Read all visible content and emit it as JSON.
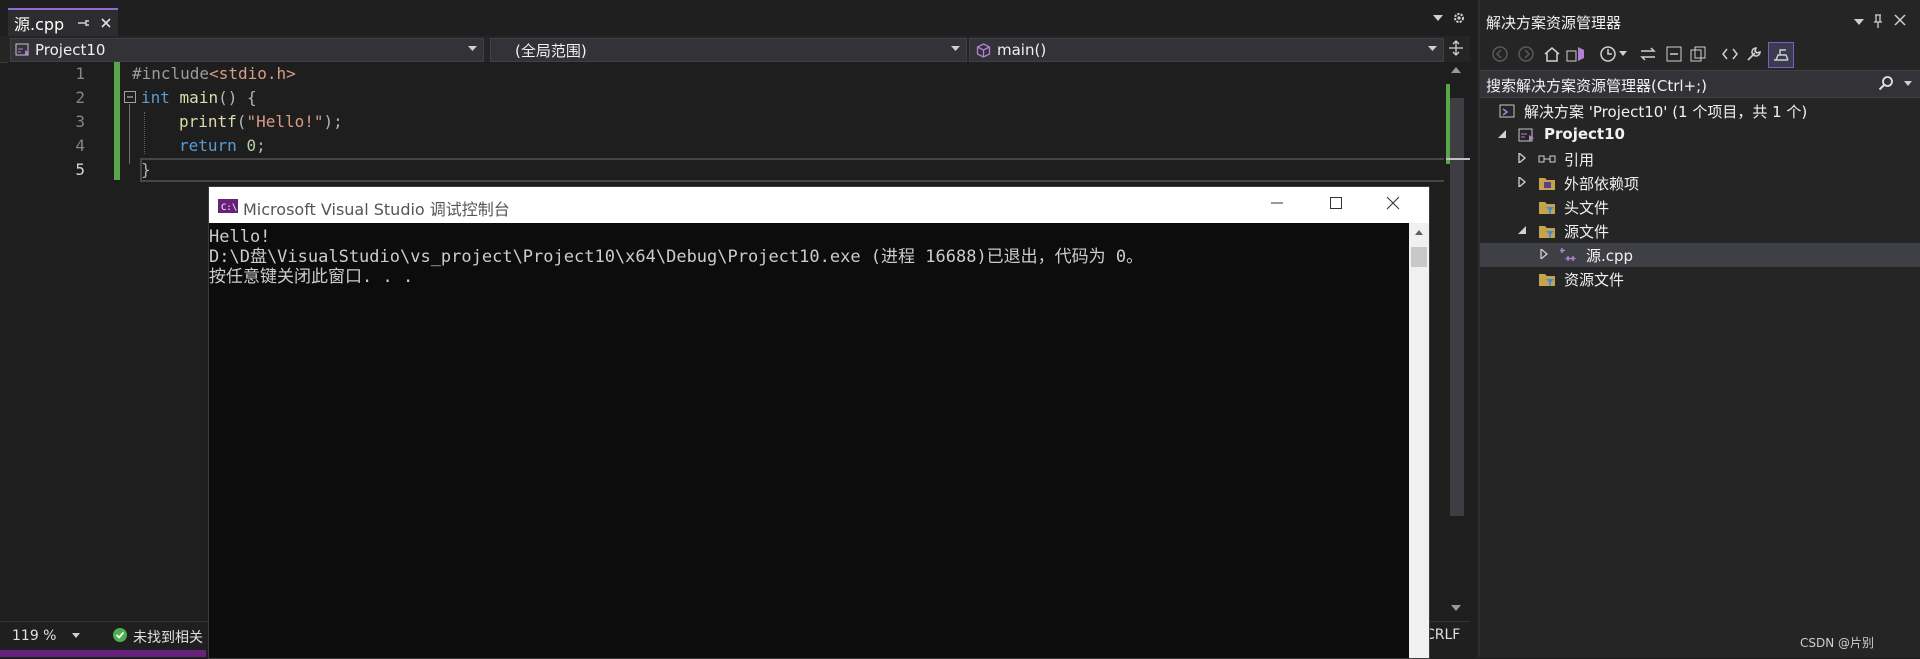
{
  "editor_tab": {
    "title": "源.cpp"
  },
  "navbar": {
    "project": "Project10",
    "scope": "(全局范围)",
    "function": "main()"
  },
  "code_lines": [
    {
      "number": "1",
      "text": "#include<stdio.h>"
    },
    {
      "number": "2",
      "text": "int main() {"
    },
    {
      "number": "3",
      "text": "printf(\"Hello!\");"
    },
    {
      "number": "4",
      "text": "return 0;"
    },
    {
      "number": "5",
      "text": "}"
    }
  ],
  "statusbar": {
    "zoom": "119 %",
    "issues": "未找到相关",
    "line_ending": "CRLF"
  },
  "console": {
    "title": "Microsoft Visual Studio 调试控制台",
    "output_lines": [
      "Hello!",
      "D:\\D盘\\VisualStudio\\vs_project\\Project10\\x64\\Debug\\Project10.exe (进程 16688)已退出，代码为 0。",
      "按任意键关闭此窗口. . ."
    ]
  },
  "solution_explorer": {
    "title": "解决方案资源管理器",
    "search_placeholder": "搜索解决方案资源管理器(Ctrl+;)",
    "tree": [
      {
        "label": "解决方案 'Project10' (1 个项目，共 1 个)",
        "icon": "solution-icon"
      },
      {
        "label": "Project10",
        "icon": "project-icon"
      },
      {
        "label": "引用",
        "icon": "references-icon"
      },
      {
        "label": "外部依赖项",
        "icon": "external-deps-icon"
      },
      {
        "label": "头文件",
        "icon": "filter-folder-icon"
      },
      {
        "label": "源文件",
        "icon": "filter-folder-icon"
      },
      {
        "label": "源.cpp",
        "icon": "cpp-file-icon"
      },
      {
        "label": "资源文件",
        "icon": "filter-folder-icon"
      }
    ]
  },
  "watermark": "CSDN @片别",
  "colors": {
    "accent": "#68217a",
    "change_bar": "#57a64a",
    "keyword": "#569cd6",
    "string": "#d69d85"
  }
}
